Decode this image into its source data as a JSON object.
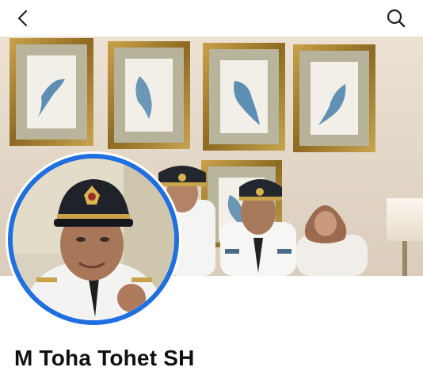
{
  "header": {
    "back_icon": "chevron-left-icon",
    "search_icon": "search-icon"
  },
  "cover": {
    "description_icon": "cover-photo"
  },
  "profile": {
    "name": "M Toha Tohet SH",
    "ring_color": "#1f6fe0"
  }
}
